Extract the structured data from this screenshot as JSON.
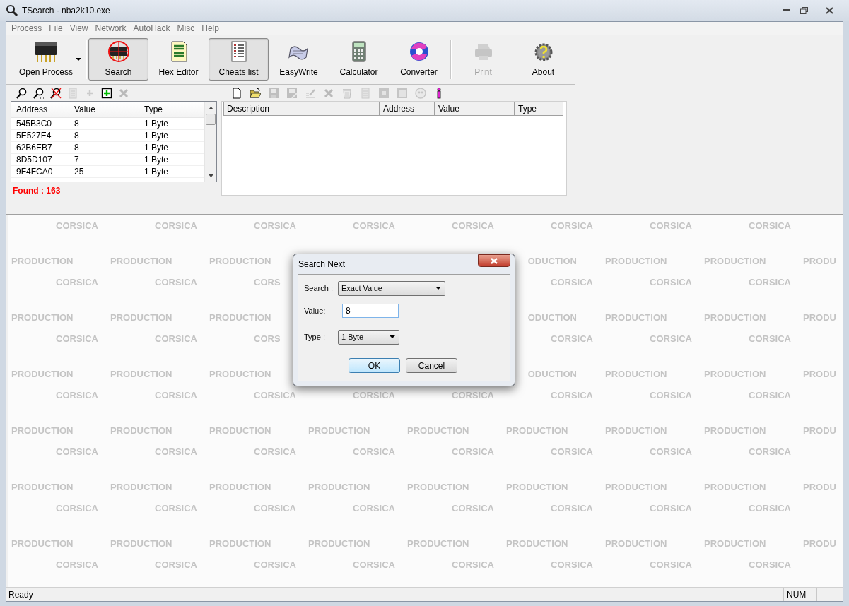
{
  "window": {
    "title": "TSearch - nba2k10.exe"
  },
  "menu": [
    "Process",
    "File",
    "View",
    "Network",
    "AutoHack",
    "Misc",
    "Help"
  ],
  "toolbar": [
    {
      "label": "Open Process",
      "selected": false,
      "disabled": false,
      "dropdown": true
    },
    {
      "label": "Search",
      "selected": true,
      "disabled": false,
      "dropdown": false
    },
    {
      "label": "Hex Editor",
      "selected": false,
      "disabled": false,
      "dropdown": false
    },
    {
      "label": "Cheats list",
      "selected": true,
      "disabled": false,
      "dropdown": false
    },
    {
      "label": "EasyWrite",
      "selected": false,
      "disabled": false,
      "dropdown": false
    },
    {
      "label": "Calculator",
      "selected": false,
      "disabled": false,
      "dropdown": false
    },
    {
      "label": "Converter",
      "selected": false,
      "disabled": false,
      "dropdown": false
    },
    {
      "label": "Print",
      "selected": false,
      "disabled": true,
      "dropdown": false
    },
    {
      "label": "About",
      "selected": false,
      "disabled": false,
      "dropdown": false
    }
  ],
  "search_panel": {
    "tools": [
      {
        "disabled": false
      },
      {
        "disabled": false
      },
      {
        "disabled": false
      },
      {
        "disabled": true
      },
      {
        "disabled": true
      },
      {
        "disabled": false
      },
      {
        "disabled": true
      }
    ],
    "columns": [
      "Address",
      "Value",
      "Type"
    ],
    "rows": [
      {
        "address": "545B3C0",
        "value": "8",
        "type": "1 Byte"
      },
      {
        "address": "5E527E4",
        "value": "8",
        "type": "1 Byte"
      },
      {
        "address": "62B6EB7",
        "value": "8",
        "type": "1 Byte"
      },
      {
        "address": "8D5D107",
        "value": "7",
        "type": "1 Byte"
      },
      {
        "address": "9F4FCA0",
        "value": "25",
        "type": "1 Byte"
      }
    ],
    "found": "Found : 163"
  },
  "cheats_list": {
    "tools": [
      {
        "disabled": false
      },
      {
        "disabled": false
      },
      {
        "disabled": true
      },
      {
        "disabled": true
      },
      {
        "disabled": true
      },
      {
        "disabled": true
      },
      {
        "disabled": true
      },
      {
        "disabled": true
      },
      {
        "disabled": true
      },
      {
        "disabled": true
      },
      {
        "disabled": true
      },
      {
        "disabled": false
      }
    ],
    "columns": [
      "Description",
      "Address",
      "Value",
      "Type"
    ]
  },
  "background": [
    {
      "kind": "corsica",
      "tiles": [
        "CORSICA",
        "CORSICA",
        "CORSICA",
        "CORSICA",
        "CORSICA",
        "CORSICA",
        "CORSICA",
        "CORSICA"
      ]
    },
    {
      "kind": "production",
      "tiles": [
        "PRODUCTION",
        "PRODUCTION",
        "PRODUCTION"
      ],
      "tiles_after_dialog": [
        "ODUCTION",
        "PRODUCTION",
        "PRODUCTION",
        "PRODU"
      ]
    },
    {
      "kind": "corsica",
      "tiles": [
        "CORSICA",
        "CORSICA",
        "CORS"
      ],
      "tiles_after_dialog": [
        "CORSICA",
        "CORSICA",
        "CORSICA"
      ]
    },
    {
      "kind": "production",
      "tiles": [
        "PRODUCTION",
        "PRODUCTION",
        "PRODUCTION"
      ],
      "tiles_after_dialog": [
        "ODUCTION",
        "PRODUCTION",
        "PRODUCTION",
        "PRODU"
      ]
    },
    {
      "kind": "corsica",
      "tiles": [
        "CORSICA",
        "CORSICA",
        "CORS"
      ],
      "tiles_after_dialog": [
        "CORSICA",
        "CORSICA",
        "CORSICA"
      ]
    },
    {
      "kind": "production",
      "tiles": [
        "PRODUCTION",
        "PRODUCTION",
        "PRODUCTION"
      ],
      "tiles_after_dialog": [
        "ODUCTION",
        "PRODUCTION",
        "PRODUCTION",
        "PRODU"
      ]
    },
    {
      "kind": "corsica",
      "tiles": [
        "CORSICA",
        "CORSICA",
        "CORSICA",
        "CORSICA",
        "CORSICA",
        "CORSICA",
        "CORSICA",
        "CORSICA"
      ]
    },
    {
      "kind": "production",
      "tiles": [
        "PRODUCTION",
        "PRODUCTION",
        "PRODUCTION",
        "PRODUCTION",
        "PRODUCTION",
        "PRODUCTION",
        "PRODUCTION",
        "PRODUCTION",
        "PRODU"
      ]
    },
    {
      "kind": "corsica",
      "tiles": [
        "CORSICA",
        "CORSICA",
        "CORSICA",
        "CORSICA",
        "CORSICA",
        "CORSICA",
        "CORSICA",
        "CORSICA"
      ]
    },
    {
      "kind": "production",
      "tiles": [
        "PRODUCTION",
        "PRODUCTION",
        "PRODUCTION",
        "PRODUCTION",
        "PRODUCTION",
        "PRODUCTION",
        "PRODUCTION",
        "PRODUCTION",
        "PRODU"
      ]
    },
    {
      "kind": "corsica",
      "tiles": [
        "CORSICA",
        "CORSICA",
        "CORSICA",
        "CORSICA",
        "CORSICA",
        "CORSICA",
        "CORSICA",
        "CORSICA"
      ]
    },
    {
      "kind": "production",
      "tiles": [
        "PRODUCTION",
        "PRODUCTION",
        "PRODUCTION",
        "PRODUCTION",
        "PRODUCTION",
        "PRODUCTION",
        "PRODUCTION",
        "PRODUCTION",
        "PRODU"
      ]
    },
    {
      "kind": "corsica",
      "tiles": [
        "CORSICA",
        "CORSICA",
        "CORSICA",
        "CORSICA",
        "CORSICA",
        "CORSICA",
        "CORSICA",
        "CORSICA"
      ]
    }
  ],
  "dialog": {
    "title": "Search Next",
    "search_label": "Search :",
    "search_value": "Exact Value",
    "value_label": "Value:",
    "value": "8",
    "type_label": "Type :",
    "type_value": "1 Byte",
    "buttons": [
      {
        "label": "OK",
        "default": true
      },
      {
        "label": "Cancel",
        "default": false
      }
    ]
  },
  "status_bar": {
    "text": "Ready",
    "indicator": "NUM"
  }
}
